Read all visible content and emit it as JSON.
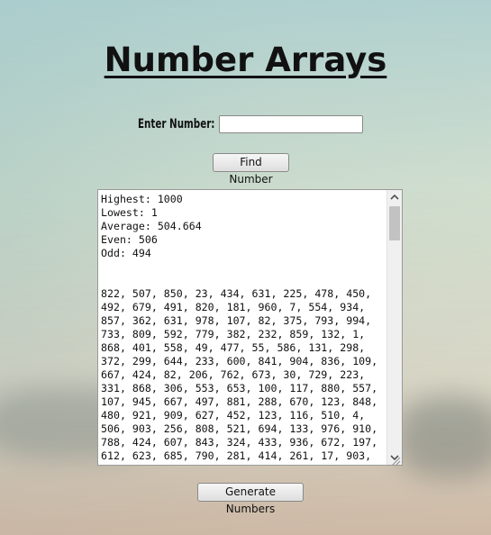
{
  "page": {
    "title": "Number Arrays"
  },
  "search": {
    "label": "Enter Number:",
    "value": "",
    "placeholder": ""
  },
  "buttons": {
    "find_label": "Find Number",
    "generate_label": "Generate Numbers"
  },
  "results": {
    "highest": "Highest: 1000",
    "lowest": "Lowest: 1",
    "average": "Average: 504.664",
    "even": "Even: 506",
    "odd": "Odd: 494",
    "number_lines": [
      "822, 507, 850, 23, 434, 631, 225, 478, 450,",
      "492, 679, 491, 820, 181, 960, 7, 554, 934,",
      "857, 362, 631, 978, 107, 82, 375, 793, 994,",
      "733, 809, 592, 779, 382, 232, 859, 132, 1,",
      "868, 401, 558, 49, 477, 55, 586, 131, 298,",
      "372, 299, 644, 233, 600, 841, 904, 836, 109,",
      "667, 424, 82, 206, 762, 673, 30, 729, 223,",
      "331, 868, 306, 553, 653, 100, 117, 880, 557,",
      "107, 945, 667, 497, 881, 288, 670, 123, 848,",
      "480, 921, 909, 627, 452, 123, 116, 510, 4,",
      "506, 903, 256, 808, 521, 694, 133, 976, 910,",
      "788, 424, 607, 843, 324, 433, 936, 672, 197,",
      "612, 623, 685, 790, 281, 414, 261, 17, 903,"
    ],
    "scroll_position": 0.0
  },
  "icons": {
    "scroll_up": "chevron-up-icon",
    "scroll_down": "chevron-down-icon",
    "resize": "resize-grip-icon"
  }
}
